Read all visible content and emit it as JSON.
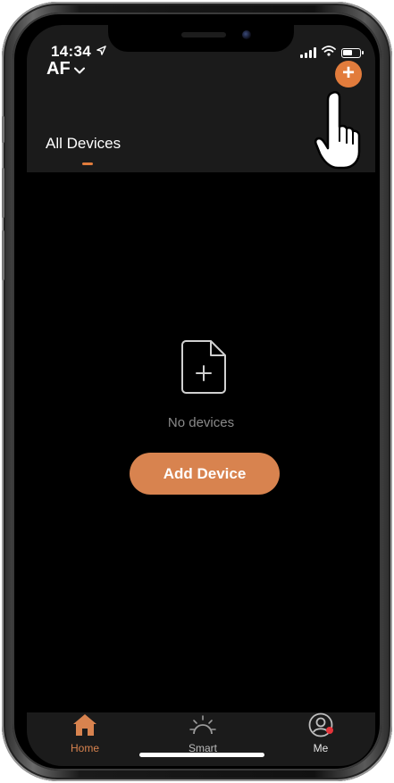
{
  "status_bar": {
    "time": "14:34",
    "location_icon": "location-arrow-icon",
    "signal_icon": "signal-icon",
    "wifi_icon": "wifi-icon",
    "battery_icon": "battery-icon"
  },
  "header": {
    "home_name": "AF",
    "home_dropdown_icon": "chevron-down-icon",
    "add_icon": "plus-icon",
    "accent_color": "#e27c3c"
  },
  "tabs": {
    "active": "All Devices"
  },
  "empty_state": {
    "icon": "file-add-icon",
    "message": "No devices",
    "button_label": "Add Device"
  },
  "bottom_nav": {
    "items": [
      {
        "label": "Home",
        "icon": "home-icon",
        "active": true
      },
      {
        "label": "Smart",
        "icon": "sun-icon",
        "active": false
      },
      {
        "label": "Me",
        "icon": "user-icon",
        "active": false,
        "badge": true
      }
    ]
  },
  "colors": {
    "background": "#000000",
    "header_bg": "#1b1b1b",
    "accent": "#e27c3c",
    "button": "#d8834f",
    "muted_text": "#8a8a8a",
    "badge": "#e5343a"
  }
}
